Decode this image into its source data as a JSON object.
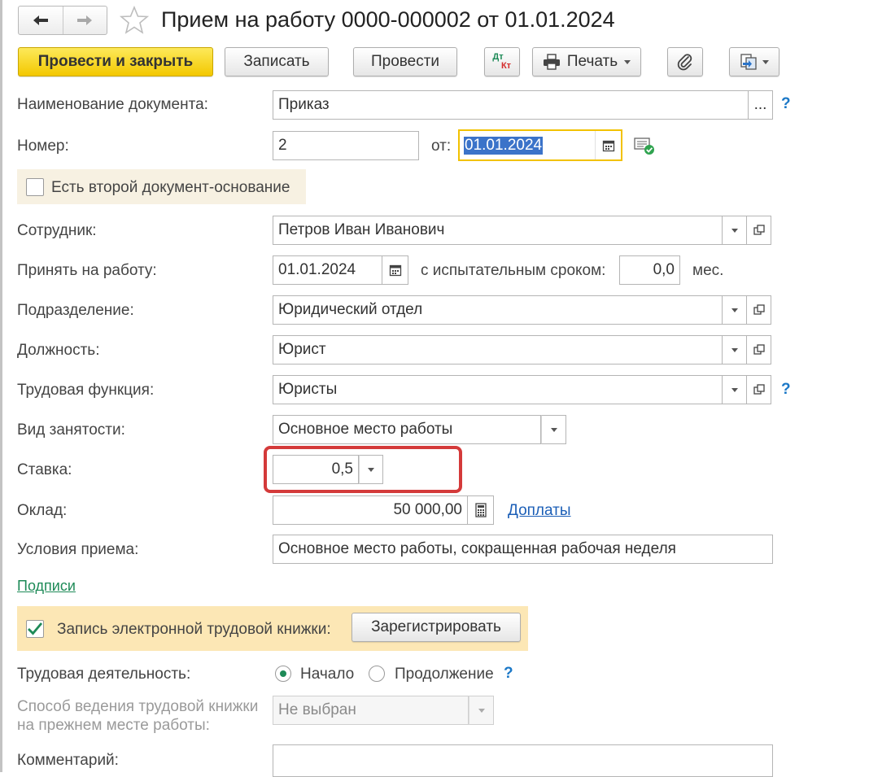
{
  "window": {
    "title": "Прием на работу 0000-000002 от 01.01.2024"
  },
  "toolbar": {
    "post_close": "Провести и закрыть",
    "save": "Записать",
    "post": "Провести",
    "dtkt_top": "Дт",
    "dtkt_bottom": "Кт",
    "print": "Печать"
  },
  "form": {
    "doc_name": {
      "label": "Наименование документа:",
      "value": "Приказ",
      "help": "?",
      "choose": "..."
    },
    "number": {
      "label": "Номер:",
      "value": "2",
      "date_label": "от:",
      "date_value": "01.01.2024"
    },
    "second_doc": {
      "label": "Есть второй документ-основание",
      "checked": false
    },
    "employee": {
      "label": "Сотрудник:",
      "value": "Петров Иван Иванович"
    },
    "hire_date": {
      "label": "Принять на работу:",
      "value": "01.01.2024",
      "probation_label": "с испытательным сроком:",
      "probation_value": "0,0",
      "probation_unit": "мес."
    },
    "department": {
      "label": "Подразделение:",
      "value": "Юридический отдел"
    },
    "position": {
      "label": "Должность:",
      "value": "Юрист"
    },
    "labor_function": {
      "label": "Трудовая функция:",
      "value": "Юристы",
      "help": "?"
    },
    "employment_type": {
      "label": "Вид занятости:",
      "value": "Основное место работы"
    },
    "rate": {
      "label": "Ставка:",
      "value": "0,5"
    },
    "salary": {
      "label": "Оклад:",
      "value": "50 000,00",
      "link": "Доплаты"
    },
    "conditions": {
      "label": "Условия приема:",
      "value": "Основное место работы, сокращенная рабочая неделя"
    },
    "signatures_link": "Подписи",
    "etk": {
      "label": "Запись электронной трудовой книжки:",
      "checked": true,
      "register": "Зарегистрировать"
    },
    "labor_activity": {
      "label": "Трудовая деятельность:",
      "option_start": "Начало",
      "option_continue": "Продолжение",
      "selected": "Начало",
      "help": "?"
    },
    "book_method": {
      "label_line1": "Способ ведения трудовой книжки",
      "label_line2": "на прежнем месте работы:",
      "value": "Не выбран"
    },
    "comment": {
      "label": "Комментарий:",
      "value": ""
    }
  },
  "colors": {
    "primary_button": "#f3c800",
    "highlight_frame": "#d43a3a",
    "focus_border": "#f2c200",
    "link": "#1c5fb7",
    "green_link": "#1d8a57",
    "help": "#1b78c7"
  }
}
